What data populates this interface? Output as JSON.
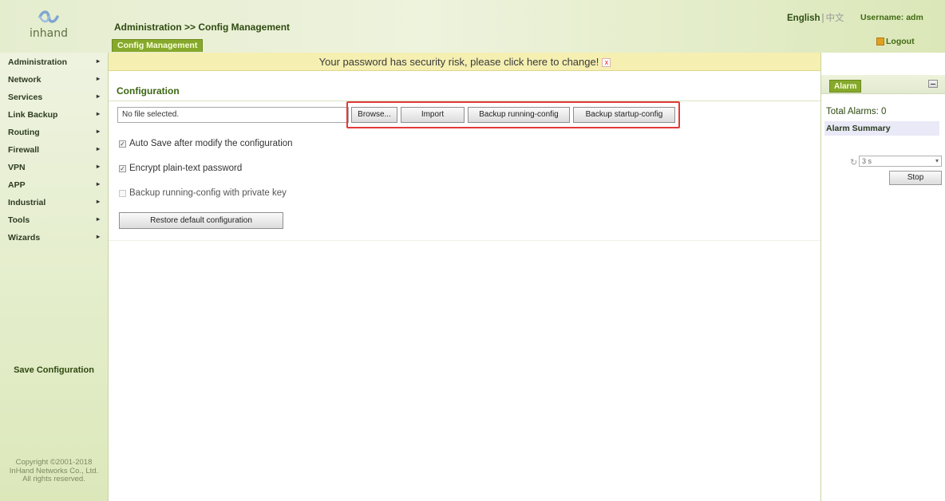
{
  "header": {
    "logo_text": "inhand",
    "breadcrumb": "Administration >> Config Management",
    "subtab": "Config Management",
    "lang_en": "English",
    "lang_sep": "|",
    "lang_zh": "中文",
    "username": "Username: adm",
    "logout": "Logout"
  },
  "sidebar": {
    "items": [
      {
        "label": "Administration"
      },
      {
        "label": "Network"
      },
      {
        "label": "Services"
      },
      {
        "label": "Link Backup"
      },
      {
        "label": "Routing"
      },
      {
        "label": "Firewall"
      },
      {
        "label": "VPN"
      },
      {
        "label": "APP"
      },
      {
        "label": "Industrial"
      },
      {
        "label": "Tools"
      },
      {
        "label": "Wizards"
      }
    ],
    "save_config": "Save Configuration",
    "copyright_1": "Copyright ©2001-2018",
    "copyright_2": "InHand Networks Co., Ltd.",
    "copyright_3": "All rights reserved."
  },
  "main": {
    "warning": "Your password has security risk, please click here to change!",
    "warning_close": "x",
    "section_title": "Configuration",
    "file_input_value": "No file selected.",
    "buttons": {
      "browse": "Browse...",
      "import": "Import",
      "backup_running": "Backup running-config",
      "backup_startup": "Backup startup-config",
      "restore": "Restore default configuration"
    },
    "checks": {
      "auto_save": {
        "label": "Auto Save after modify the configuration",
        "checked": true
      },
      "encrypt": {
        "label": "Encrypt plain-text password",
        "checked": true
      },
      "private_key": {
        "label": "Backup running-config with private key",
        "checked": false
      }
    }
  },
  "right_panel": {
    "tab": "Alarm",
    "total_alarms": "Total Alarms: 0",
    "alarm_summary": "Alarm Summary",
    "refresh_value": "3 s",
    "stop": "Stop"
  }
}
